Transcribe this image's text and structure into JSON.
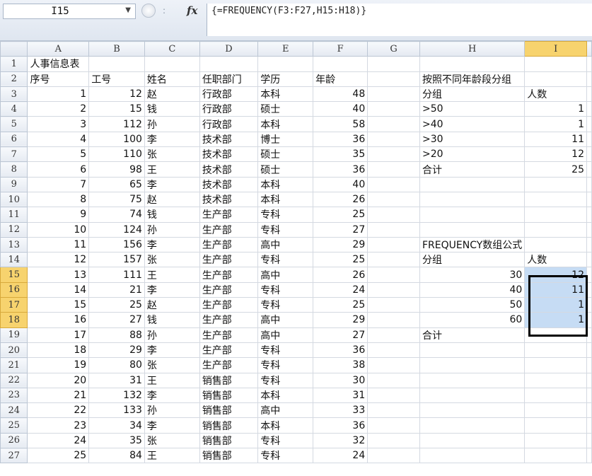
{
  "formula_bar": {
    "name_box": "I15",
    "dropdown_icon": "chevron-down-icon",
    "separator": ":",
    "fx_label": "fx",
    "formula": "{=FREQUENCY(F3:F27,H15:H18)}"
  },
  "columns": [
    "A",
    "B",
    "C",
    "D",
    "E",
    "F",
    "G",
    "H",
    "I"
  ],
  "rows": [
    {
      "n": "1",
      "c": [
        "人事信息表",
        "",
        "",
        "",
        "",
        "",
        "",
        "",
        ""
      ]
    },
    {
      "n": "2",
      "c": [
        "序号",
        "工号",
        "姓名",
        "任职部门",
        "学历",
        "年龄",
        "",
        "按照不同年龄段分组",
        ""
      ]
    },
    {
      "n": "3",
      "c": [
        "1",
        "12",
        "赵",
        "行政部",
        "本科",
        "48",
        "",
        "分组",
        "人数"
      ]
    },
    {
      "n": "4",
      "c": [
        "2",
        "15",
        "钱",
        "行政部",
        "硕士",
        "40",
        "",
        ">50",
        "1"
      ]
    },
    {
      "n": "5",
      "c": [
        "3",
        "112",
        "孙",
        "行政部",
        "本科",
        "58",
        "",
        ">40",
        "1"
      ]
    },
    {
      "n": "6",
      "c": [
        "4",
        "100",
        "李",
        "技术部",
        "博士",
        "36",
        "",
        ">30",
        "11"
      ]
    },
    {
      "n": "7",
      "c": [
        "5",
        "110",
        "张",
        "技术部",
        "硕士",
        "35",
        "",
        ">20",
        "12"
      ]
    },
    {
      "n": "8",
      "c": [
        "6",
        "98",
        "王",
        "技术部",
        "硕士",
        "36",
        "",
        "合计",
        "25"
      ]
    },
    {
      "n": "9",
      "c": [
        "7",
        "65",
        "李",
        "技术部",
        "本科",
        "40",
        "",
        "",
        ""
      ]
    },
    {
      "n": "10",
      "c": [
        "8",
        "75",
        "赵",
        "技术部",
        "本科",
        "26",
        "",
        "",
        ""
      ]
    },
    {
      "n": "11",
      "c": [
        "9",
        "74",
        "钱",
        "生产部",
        "专科",
        "25",
        "",
        "",
        ""
      ]
    },
    {
      "n": "12",
      "c": [
        "10",
        "124",
        "孙",
        "生产部",
        "专科",
        "27",
        "",
        "",
        ""
      ]
    },
    {
      "n": "13",
      "c": [
        "11",
        "156",
        "李",
        "生产部",
        "高中",
        "29",
        "",
        "FREQUENCY数组公式",
        ""
      ]
    },
    {
      "n": "14",
      "c": [
        "12",
        "157",
        "张",
        "生产部",
        "专科",
        "25",
        "",
        "分组",
        "人数"
      ]
    },
    {
      "n": "15",
      "c": [
        "13",
        "111",
        "王",
        "生产部",
        "高中",
        "26",
        "",
        "30",
        "12"
      ]
    },
    {
      "n": "16",
      "c": [
        "14",
        "21",
        "李",
        "生产部",
        "专科",
        "24",
        "",
        "40",
        "11"
      ]
    },
    {
      "n": "17",
      "c": [
        "15",
        "25",
        "赵",
        "生产部",
        "专科",
        "25",
        "",
        "50",
        "1"
      ]
    },
    {
      "n": "18",
      "c": [
        "16",
        "27",
        "钱",
        "生产部",
        "高中",
        "29",
        "",
        "60",
        "1"
      ]
    },
    {
      "n": "19",
      "c": [
        "17",
        "88",
        "孙",
        "生产部",
        "高中",
        "27",
        "",
        "合计",
        ""
      ]
    },
    {
      "n": "20",
      "c": [
        "18",
        "29",
        "李",
        "生产部",
        "专科",
        "36",
        "",
        "",
        ""
      ]
    },
    {
      "n": "21",
      "c": [
        "19",
        "80",
        "张",
        "生产部",
        "专科",
        "38",
        "",
        "",
        ""
      ]
    },
    {
      "n": "22",
      "c": [
        "20",
        "31",
        "王",
        "销售部",
        "专科",
        "30",
        "",
        "",
        ""
      ]
    },
    {
      "n": "23",
      "c": [
        "21",
        "132",
        "李",
        "销售部",
        "本科",
        "31",
        "",
        "",
        ""
      ]
    },
    {
      "n": "24",
      "c": [
        "22",
        "133",
        "孙",
        "销售部",
        "高中",
        "33",
        "",
        "",
        ""
      ]
    },
    {
      "n": "25",
      "c": [
        "23",
        "34",
        "李",
        "销售部",
        "本科",
        "36",
        "",
        "",
        ""
      ]
    },
    {
      "n": "26",
      "c": [
        "24",
        "35",
        "张",
        "销售部",
        "专科",
        "32",
        "",
        "",
        ""
      ]
    },
    {
      "n": "27",
      "c": [
        "25",
        "84",
        "王",
        "销售部",
        "专科",
        "24",
        "",
        "",
        ""
      ]
    }
  ],
  "selection": {
    "column": "I",
    "rows": [
      "15",
      "16",
      "17",
      "18"
    ]
  },
  "colors": {
    "selected_header": "#f7d36e",
    "selected_cell": "#c6dcf4",
    "grid_line": "#d4d9e1"
  }
}
